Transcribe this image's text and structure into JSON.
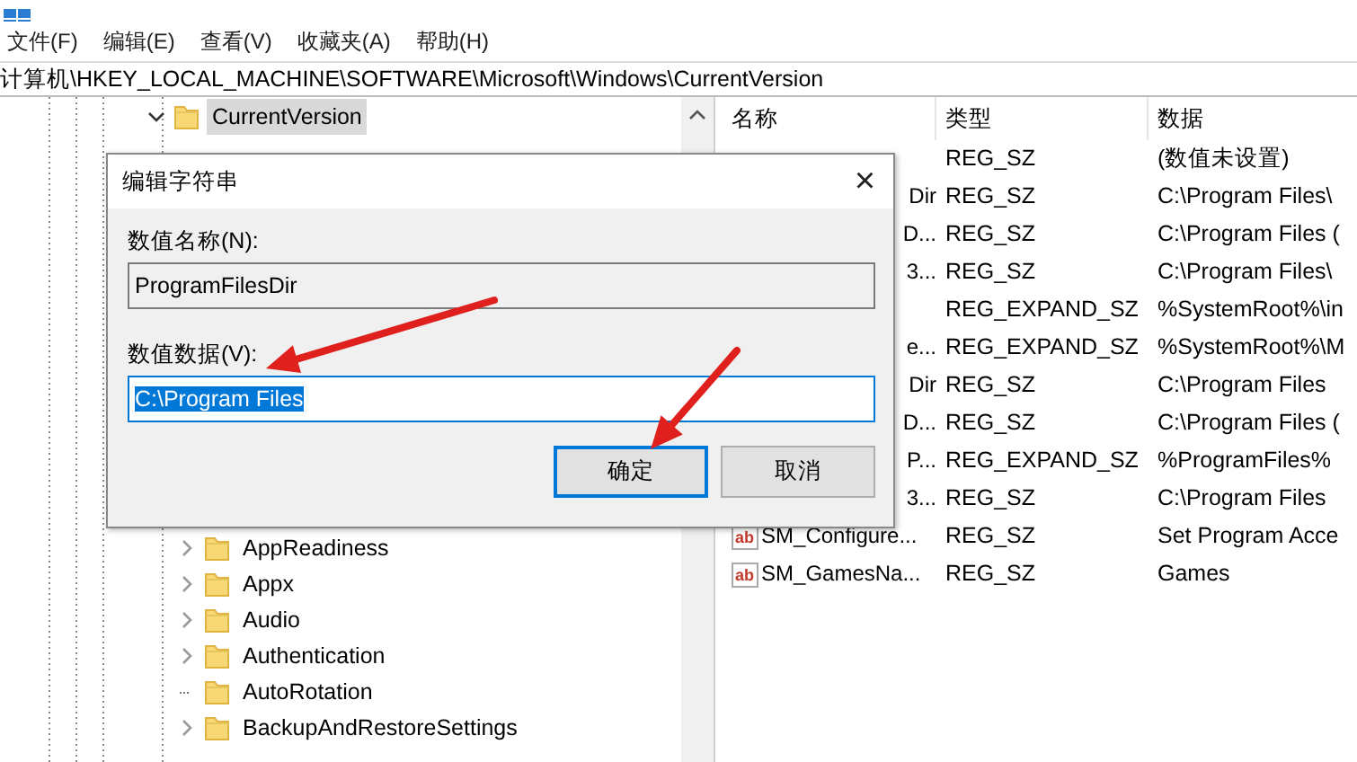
{
  "menu": [
    "文件(F)",
    "编辑(E)",
    "查看(V)",
    "收藏夹(A)",
    "帮助(H)"
  ],
  "address": "计算机\\HKEY_LOCAL_MACHINE\\SOFTWARE\\Microsoft\\Windows\\CurrentVersion",
  "tree": [
    {
      "label": "CurrentVersion",
      "selected": true,
      "expanded": true,
      "children": [
        {
          "label": "AppReadiness",
          "selected": false,
          "has_children": true
        },
        {
          "label": "Appx",
          "selected": false,
          "has_children": true
        },
        {
          "label": "Audio",
          "selected": false,
          "has_children": true
        },
        {
          "label": "Authentication",
          "selected": false,
          "has_children": true
        },
        {
          "label": "AutoRotation",
          "selected": false,
          "has_children": false
        },
        {
          "label": "BackupAndRestoreSettings",
          "selected": false,
          "has_children": true
        }
      ]
    }
  ],
  "table": {
    "columns": [
      "名称",
      "类型",
      "数据"
    ],
    "rows": [
      {
        "kind": "clipped",
        "type": "REG_SZ",
        "data": "(数值未设置)"
      },
      {
        "kind": "clipped",
        "name": "Dir",
        "type": "REG_SZ",
        "data": "C:\\Program Files\\"
      },
      {
        "kind": "clipped",
        "name": "D...",
        "type": "REG_SZ",
        "data": "C:\\Program Files ("
      },
      {
        "kind": "clipped",
        "name": "3...",
        "type": "REG_SZ",
        "data": "C:\\Program Files\\"
      },
      {
        "kind": "clipped",
        "type": "REG_EXPAND_SZ",
        "data": "%SystemRoot%\\in"
      },
      {
        "kind": "clipped",
        "name": "e...",
        "type": "REG_EXPAND_SZ",
        "data": "%SystemRoot%\\M"
      },
      {
        "kind": "clipped",
        "name": "Dir",
        "type": "REG_SZ",
        "data": "C:\\Program Files"
      },
      {
        "kind": "clipped",
        "name": "D...",
        "type": "REG_SZ",
        "data": "C:\\Program Files ("
      },
      {
        "kind": "clipped",
        "name": "P...",
        "type": "REG_EXPAND_SZ",
        "data": "%ProgramFiles%"
      },
      {
        "kind": "clipped",
        "name": "3...",
        "type": "REG_SZ",
        "data": "C:\\Program Files"
      },
      {
        "kind": "full",
        "icon": "ab",
        "name": "SM_Configure...",
        "type": "REG_SZ",
        "data": "Set Program Acce"
      },
      {
        "kind": "full",
        "icon": "ab",
        "name": "SM_GamesNa...",
        "type": "REG_SZ",
        "data": "Games"
      }
    ]
  },
  "dialog": {
    "title": "编辑字符串",
    "close": "×",
    "name_label": "数值名称(N):",
    "name_value": "ProgramFilesDir",
    "data_label": "数值数据(V):",
    "data_value": "C:\\Program Files",
    "data_selected": true,
    "buttons": [
      {
        "label": "确定",
        "default": true
      },
      {
        "label": "取消",
        "default": false
      }
    ]
  },
  "annotations": [
    {
      "kind": "arrow"
    },
    {
      "kind": "arrow"
    }
  ]
}
